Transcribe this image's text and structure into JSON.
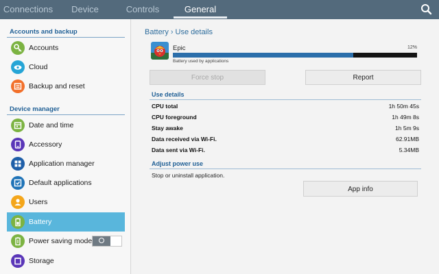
{
  "tabs": [
    {
      "label": "Connections"
    },
    {
      "label": "Device"
    },
    {
      "label": "Controls"
    },
    {
      "label": "General"
    }
  ],
  "active_tab": "General",
  "search_icon": "search-icon",
  "sidebar": {
    "sections": [
      {
        "title": "Accounts and backup",
        "items": [
          {
            "label": "Accounts",
            "icon": "key-icon",
            "color": "#7cb342"
          },
          {
            "label": "Cloud",
            "icon": "cloud-icon",
            "color": "#26a5d6"
          },
          {
            "label": "Backup and reset",
            "icon": "backup-icon",
            "color": "#f2702b"
          }
        ]
      },
      {
        "title": "Device manager",
        "items": [
          {
            "label": "Date and time",
            "icon": "calendar-icon",
            "color": "#7cb342"
          },
          {
            "label": "Accessory",
            "icon": "accessory-icon",
            "color": "#5a36b8"
          },
          {
            "label": "Application manager",
            "icon": "apps-grid-icon",
            "color": "#1f5fa8"
          },
          {
            "label": "Default applications",
            "icon": "default-apps-icon",
            "color": "#1f73b7"
          },
          {
            "label": "Users",
            "icon": "user-icon",
            "color": "#f4a61b"
          },
          {
            "label": "Battery",
            "icon": "battery-icon",
            "color": "#7cb342",
            "active": true
          },
          {
            "label": "Power saving mode",
            "icon": "power-saving-icon",
            "color": "#7cb342",
            "toggle": "off"
          },
          {
            "label": "Storage",
            "icon": "storage-icon",
            "color": "#5a36b8"
          }
        ]
      }
    ]
  },
  "breadcrumb": {
    "parent": "Battery",
    "current": "Use details"
  },
  "app": {
    "name": "Epic",
    "usage_percent_label": "12%",
    "usage_fraction": 0.74,
    "subtitle": "Battery used by applications",
    "icon": "app-icon"
  },
  "buttons": {
    "force_stop": "Force stop",
    "report": "Report",
    "app_info": "App info"
  },
  "use_details": {
    "title": "Use details",
    "rows": [
      {
        "label": "CPU total",
        "value": "1h 50m 45s"
      },
      {
        "label": "CPU foreground",
        "value": "1h 49m 8s"
      },
      {
        "label": "Stay awake",
        "value": "1h 5m 9s"
      },
      {
        "label": "Data received via Wi-Fi.",
        "value": "62.91MB"
      },
      {
        "label": "Data sent via Wi-Fi.",
        "value": "5.34MB"
      }
    ]
  },
  "adjust_power": {
    "title": "Adjust power use",
    "note": "Stop or uninstall application."
  },
  "colors": {
    "topbar": "#536a7c",
    "accent_blue": "#1f5f95",
    "active_item": "#59b6dc",
    "usage_bar": "#2b6eaa"
  }
}
